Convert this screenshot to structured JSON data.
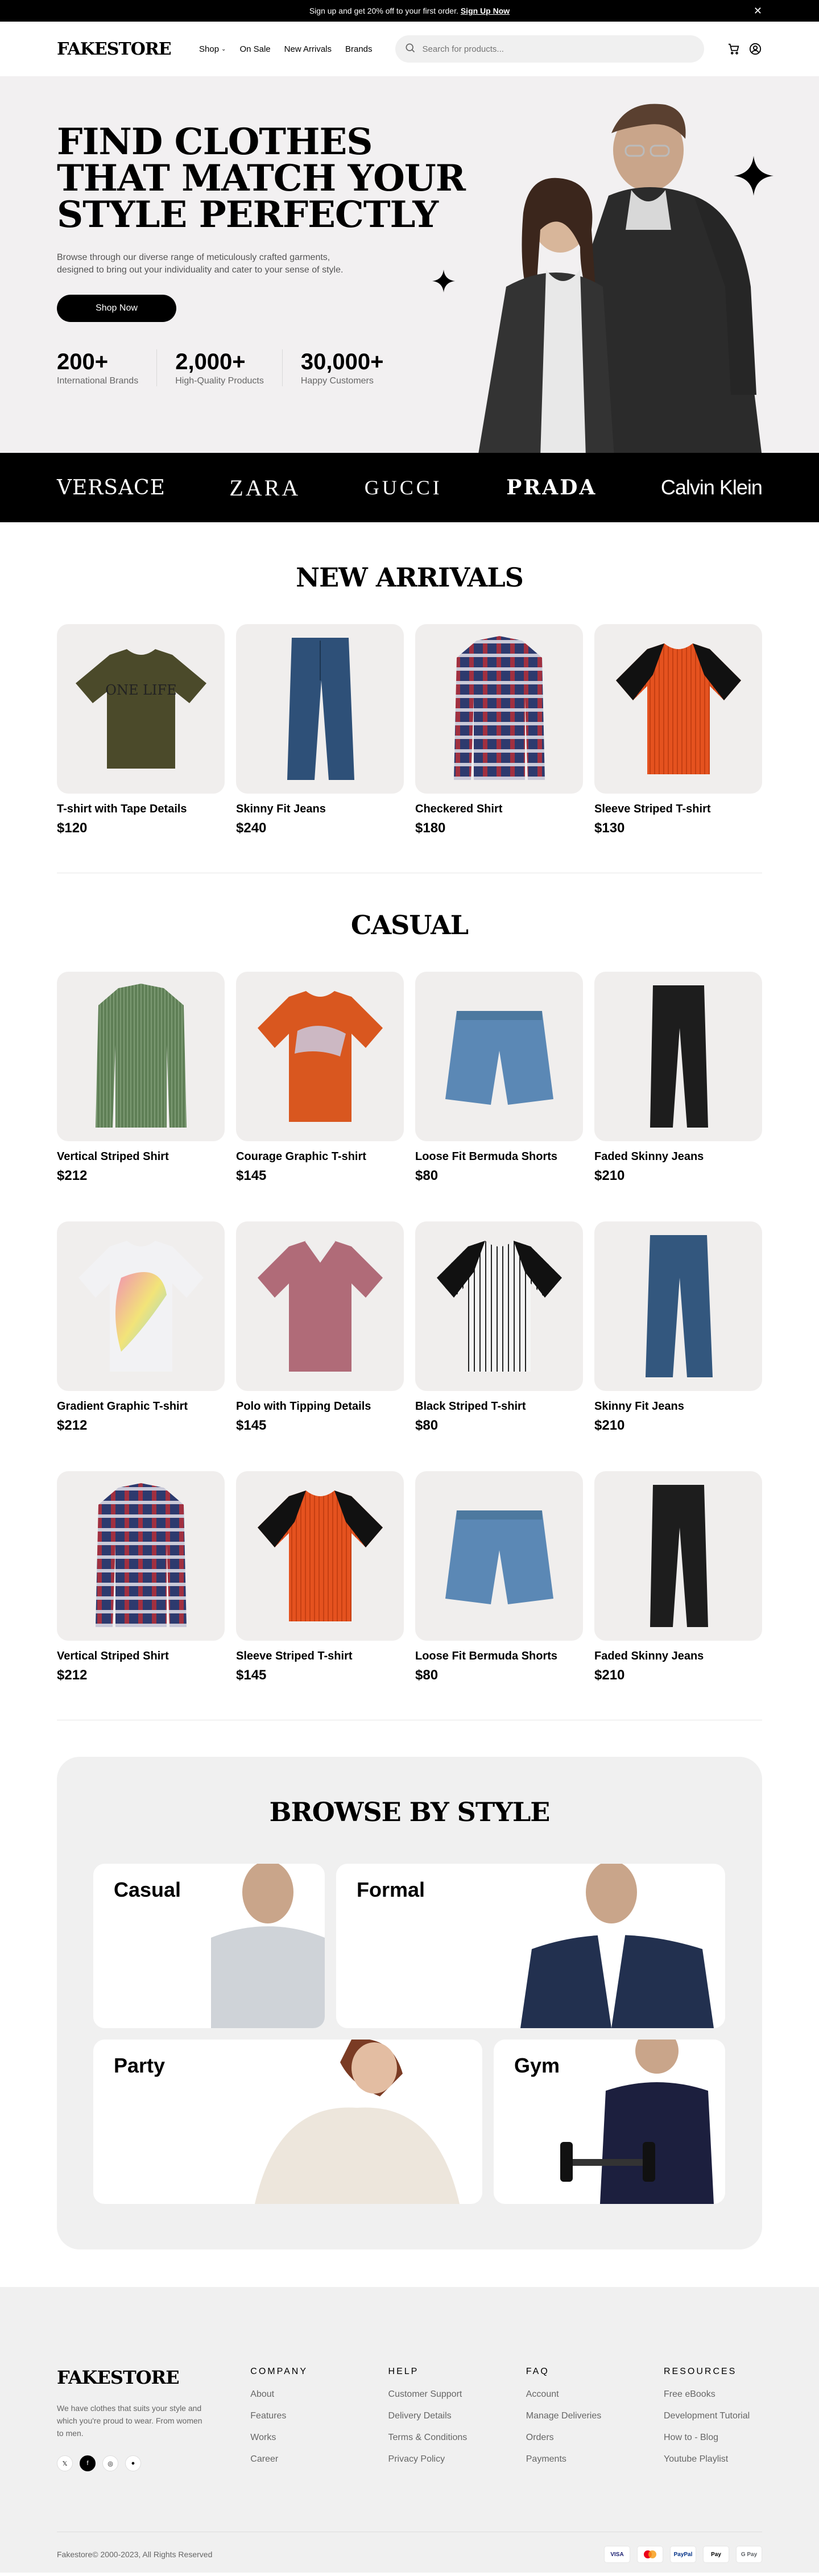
{
  "banner": {
    "text": "Sign up and get 20% off to your first order.",
    "link": "Sign Up Now"
  },
  "header": {
    "logo": "FAKESTORE",
    "nav": [
      "Shop",
      "On Sale",
      "New Arrivals",
      "Brands"
    ],
    "search_placeholder": "Search for products..."
  },
  "hero": {
    "title": "FIND CLOTHES THAT MATCH YOUR STYLE PERFECTLY",
    "description": "Browse through our diverse range of meticulously crafted garments, designed to bring out your individuality and cater to your sense of style.",
    "button": "Shop Now",
    "stats": [
      {
        "value": "200+",
        "label": "International Brands"
      },
      {
        "value": "2,000+",
        "label": "High-Quality Products"
      },
      {
        "value": "30,000+",
        "label": "Happy Customers"
      }
    ]
  },
  "brands": [
    "VERSACE",
    "ZARA",
    "GUCCI",
    "PRADA",
    "Calvin Klein"
  ],
  "new_arrivals": {
    "title": "NEW ARRIVALS",
    "products": [
      {
        "name": "T-shirt with Tape Details",
        "price": "$120"
      },
      {
        "name": "Skinny Fit Jeans",
        "price": "$240"
      },
      {
        "name": "Checkered Shirt",
        "price": "$180"
      },
      {
        "name": "Sleeve Striped T-shirt",
        "price": "$130"
      }
    ]
  },
  "casual": {
    "title": "CASUAL",
    "products": [
      {
        "name": "Vertical Striped Shirt",
        "price": "$212"
      },
      {
        "name": "Courage Graphic T-shirt",
        "price": "$145"
      },
      {
        "name": "Loose Fit Bermuda Shorts",
        "price": "$80"
      },
      {
        "name": "Faded Skinny Jeans",
        "price": "$210"
      },
      {
        "name": "Gradient Graphic T-shirt",
        "price": "$212"
      },
      {
        "name": "Polo with Tipping Details",
        "price": "$145"
      },
      {
        "name": "Black Striped T-shirt",
        "price": "$80"
      },
      {
        "name": "Skinny Fit Jeans",
        "price": "$210"
      },
      {
        "name": "Vertical Striped Shirt",
        "price": "$212"
      },
      {
        "name": "Sleeve Striped T-shirt",
        "price": "$145"
      },
      {
        "name": "Loose Fit Bermuda Shorts",
        "price": "$80"
      },
      {
        "name": "Faded Skinny Jeans",
        "price": "$210"
      }
    ]
  },
  "browse": {
    "title": "BROWSE BY STYLE",
    "styles": [
      "Casual",
      "Formal",
      "Party",
      "Gym"
    ]
  },
  "footer": {
    "logo": "FAKESTORE",
    "description": "We have clothes that suits your style and which you're proud to wear. From women to men.",
    "columns": [
      {
        "title": "COMPANY",
        "links": [
          "About",
          "Features",
          "Works",
          "Career"
        ]
      },
      {
        "title": "HELP",
        "links": [
          "Customer Support",
          "Delivery Details",
          "Terms & Conditions",
          "Privacy Policy"
        ]
      },
      {
        "title": "FAQ",
        "links": [
          "Account",
          "Manage Deliveries",
          "Orders",
          "Payments"
        ]
      },
      {
        "title": "RESOURCES",
        "links": [
          "Free eBooks",
          "Development Tutorial",
          "How to - Blog",
          "Youtube Playlist"
        ]
      }
    ],
    "copyright": "Fakestore© 2000-2023, All Rights Reserved",
    "payments": [
      "VISA",
      "MC",
      "PayPal",
      "Pay",
      "G Pay"
    ]
  },
  "colors": {
    "accent": "#000000",
    "card_bg": "#f0eeed",
    "hero_bg": "#f2f0f1"
  },
  "icons": [
    "close-icon",
    "chevron-down-icon",
    "search-icon",
    "cart-icon",
    "user-icon",
    "twitter-icon",
    "facebook-icon",
    "instagram-icon",
    "github-icon"
  ]
}
